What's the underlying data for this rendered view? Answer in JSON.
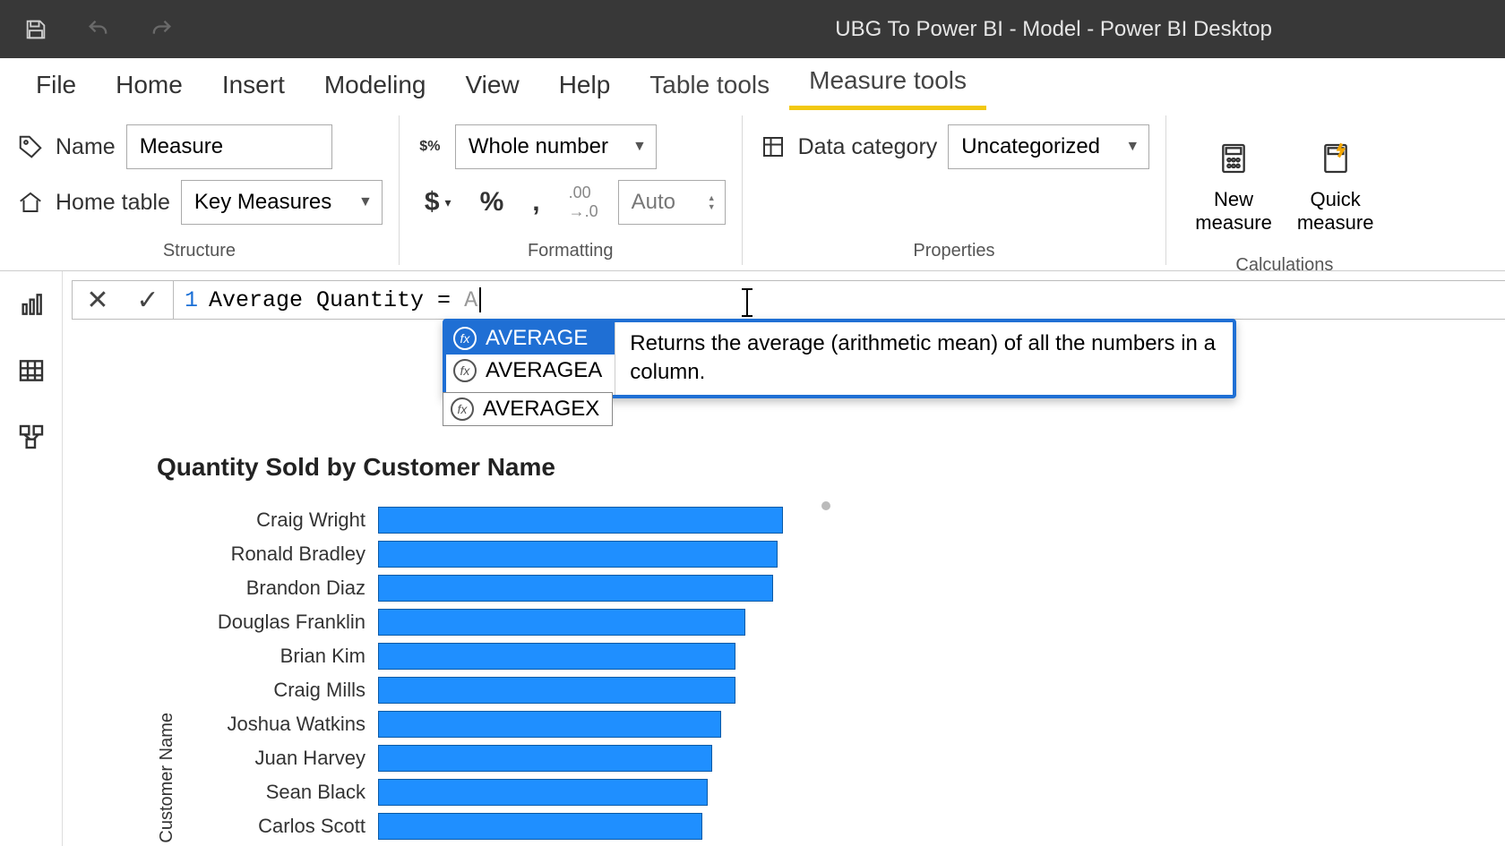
{
  "titlebar": {
    "title": "UBG To Power BI - Model - Power BI Desktop"
  },
  "ribbon_tabs": [
    "File",
    "Home",
    "Insert",
    "Modeling",
    "View",
    "Help",
    "Table tools",
    "Measure tools"
  ],
  "active_tab_index": 7,
  "structure": {
    "name_label": "Name",
    "name_value": "Measure",
    "home_table_label": "Home table",
    "home_table_value": "Key Measures",
    "group_label": "Structure"
  },
  "formatting": {
    "format_value": "Whole number",
    "decimal_placeholder": "Auto",
    "group_label": "Formatting"
  },
  "properties": {
    "category_label": "Data category",
    "category_value": "Uncategorized",
    "group_label": "Properties"
  },
  "calculations": {
    "new_measure": "New\nmeasure",
    "quick_measure": "Quick\nmeasure",
    "group_label": "Calculations"
  },
  "formula": {
    "line_number": "1",
    "text": "Average Quantity ="
  },
  "autocomplete": {
    "items": [
      "AVERAGE",
      "AVERAGEA",
      "AVERAGEX"
    ],
    "selected_index": 0,
    "description": "Returns the average (arithmetic mean) of all the numbers in a column."
  },
  "chart_data": {
    "type": "bar",
    "title": "Quantity Sold by Customer Name",
    "ylabel": "Customer Name",
    "xlabel": "",
    "xlim": [
      0,
      100
    ],
    "categories": [
      "Craig Wright",
      "Ronald Bradley",
      "Brandon Diaz",
      "Douglas Franklin",
      "Brian Kim",
      "Craig Mills",
      "Joshua Watkins",
      "Juan Harvey",
      "Sean Black",
      "Carlos Scott"
    ],
    "values": [
      86,
      85,
      84,
      78,
      76,
      76,
      73,
      71,
      70,
      69
    ]
  }
}
